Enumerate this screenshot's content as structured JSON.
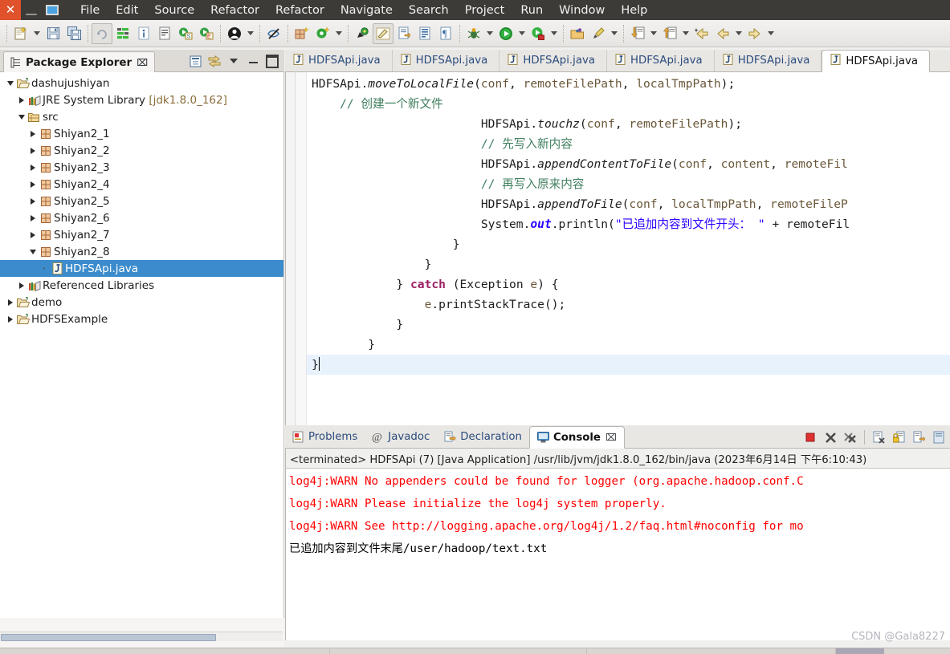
{
  "window": {
    "controls": [
      {
        "name": "close",
        "glyph": "✕"
      },
      {
        "name": "minimize",
        "glyph": "—"
      },
      {
        "name": "maximize",
        "glyph": ""
      }
    ],
    "menus": [
      "File",
      "Edit",
      "Source",
      "Refactor",
      "Refactor",
      "Navigate",
      "Search",
      "Project",
      "Run",
      "Window",
      "Help"
    ]
  },
  "toolbar": {
    "items": [
      {
        "icon": "new-wizard-icon",
        "dropdown": true
      },
      {
        "icon": "save-icon",
        "dropdown": false
      },
      {
        "icon": "save-all-icon",
        "dropdown": false
      },
      {
        "icon": "refresh-icon",
        "dropdown": false
      },
      {
        "icon": "build-all-icon",
        "dropdown": false
      },
      {
        "icon": "info-icon",
        "dropdown": false
      },
      {
        "icon": "open-task-icon",
        "dropdown": false
      },
      {
        "icon": "new-java-project-icon",
        "dropdown": false
      },
      {
        "icon": "new-ee-project-icon",
        "dropdown": false
      },
      {
        "icon": "user-icon",
        "dropdown": true
      },
      {
        "icon": "skip-breakpoints-icon",
        "dropdown": false
      },
      {
        "icon": "new-package-icon",
        "dropdown": false
      },
      {
        "icon": "new-class-icon",
        "dropdown": true
      },
      {
        "icon": "search-icon",
        "dropdown": false
      },
      {
        "icon": "pencil-highlight-icon",
        "dropdown": false
      },
      {
        "icon": "next-annotation-icon",
        "dropdown": false
      },
      {
        "icon": "toggle-block-selection-icon",
        "dropdown": false
      },
      {
        "icon": "show-whitespace-icon",
        "dropdown": false
      },
      {
        "icon": "debug-icon",
        "dropdown": true
      },
      {
        "icon": "run-icon",
        "dropdown": true
      },
      {
        "icon": "run-external-tools-icon",
        "dropdown": true
      },
      {
        "icon": "open-perspective-icon",
        "dropdown": false
      },
      {
        "icon": "quick-access-icon",
        "dropdown": true
      },
      {
        "icon": "download-icon",
        "dropdown": true
      },
      {
        "icon": "upload-icon",
        "dropdown": true
      },
      {
        "icon": "back-start-icon",
        "dropdown": false
      },
      {
        "icon": "back-icon",
        "dropdown": true
      },
      {
        "icon": "forward-icon",
        "dropdown": true
      }
    ]
  },
  "package_explorer": {
    "title": "Package Explorer",
    "close_glyph": "⌧",
    "tools": [
      {
        "name": "collapse-all-icon"
      },
      {
        "name": "link-with-editor-icon"
      },
      {
        "name": "view-menu-icon"
      },
      {
        "name": "minimize-view-icon"
      },
      {
        "name": "maximize-view-icon"
      }
    ],
    "tree": [
      {
        "label": "dashujushiyan",
        "indent": 0,
        "twist": "open",
        "icon": "project-icon",
        "selected": false
      },
      {
        "label": "JRE System Library ",
        "suffix": "[jdk1.8.0_162]",
        "indent": 1,
        "twist": "closed",
        "icon": "library-icon",
        "selected": false
      },
      {
        "label": "src",
        "indent": 1,
        "twist": "open",
        "icon": "source-folder-icon",
        "selected": false
      },
      {
        "label": "Shiyan2_1",
        "indent": 2,
        "twist": "closed",
        "icon": "package-icon",
        "selected": false
      },
      {
        "label": "Shiyan2_2",
        "indent": 2,
        "twist": "closed",
        "icon": "package-icon",
        "selected": false
      },
      {
        "label": "Shiyan2_3",
        "indent": 2,
        "twist": "closed",
        "icon": "package-icon",
        "selected": false
      },
      {
        "label": "Shiyan2_4",
        "indent": 2,
        "twist": "closed",
        "icon": "package-icon",
        "selected": false
      },
      {
        "label": "Shiyan2_5",
        "indent": 2,
        "twist": "closed",
        "icon": "package-icon",
        "selected": false
      },
      {
        "label": "Shiyan2_6",
        "indent": 2,
        "twist": "closed",
        "icon": "package-icon",
        "selected": false
      },
      {
        "label": "Shiyan2_7",
        "indent": 2,
        "twist": "closed",
        "icon": "package-icon",
        "selected": false
      },
      {
        "label": "Shiyan2_8",
        "indent": 2,
        "twist": "open",
        "icon": "package-icon",
        "selected": false
      },
      {
        "label": "HDFSApi.java",
        "indent": 3,
        "twist": "dot",
        "icon": "java-file-icon",
        "selected": true
      },
      {
        "label": "Referenced Libraries",
        "indent": 1,
        "twist": "closed",
        "icon": "library-icon",
        "selected": false
      },
      {
        "label": "demo",
        "indent": 0,
        "twist": "closed",
        "icon": "project-icon",
        "selected": false
      },
      {
        "label": "HDFSExample",
        "indent": 0,
        "twist": "closed",
        "icon": "project-icon",
        "selected": false
      }
    ]
  },
  "editor": {
    "tabs": [
      {
        "label": "HDFSApi.java",
        "active": false
      },
      {
        "label": "HDFSApi.java",
        "active": false
      },
      {
        "label": "HDFSApi.java",
        "active": false
      },
      {
        "label": "HDFSApi.java",
        "active": false
      },
      {
        "label": "HDFSApi.java",
        "active": false
      },
      {
        "label": "HDFSApi.java",
        "active": true
      }
    ],
    "code_lines": [
      {
        "current": false,
        "tokens": [
          {
            "t": "txt",
            "s": "HDFSApi."
          },
          {
            "t": "mth",
            "s": "moveToLocalFile"
          },
          {
            "t": "txt",
            "s": "("
          },
          {
            "t": "par",
            "s": "conf"
          },
          {
            "t": "txt",
            "s": ", "
          },
          {
            "t": "par",
            "s": "remoteFilePath"
          },
          {
            "t": "txt",
            "s": ", "
          },
          {
            "t": "par",
            "s": "localTmpPath"
          },
          {
            "t": "txt",
            "s": ");"
          }
        ]
      },
      {
        "current": false,
        "tokens": [
          {
            "t": "cmt",
            "s": "    // 创建一个新文件"
          }
        ]
      },
      {
        "current": false,
        "tokens": [
          {
            "t": "txt",
            "s": "                        HDFSApi."
          },
          {
            "t": "mth",
            "s": "touchz"
          },
          {
            "t": "txt",
            "s": "("
          },
          {
            "t": "par",
            "s": "conf"
          },
          {
            "t": "txt",
            "s": ", "
          },
          {
            "t": "par",
            "s": "remoteFilePath"
          },
          {
            "t": "txt",
            "s": ");"
          }
        ]
      },
      {
        "current": false,
        "tokens": [
          {
            "t": "cmt",
            "s": "                        // 先写入新内容"
          }
        ]
      },
      {
        "current": false,
        "tokens": [
          {
            "t": "txt",
            "s": "                        HDFSApi."
          },
          {
            "t": "mth",
            "s": "appendContentToFile"
          },
          {
            "t": "txt",
            "s": "("
          },
          {
            "t": "par",
            "s": "conf"
          },
          {
            "t": "txt",
            "s": ", "
          },
          {
            "t": "par",
            "s": "content"
          },
          {
            "t": "txt",
            "s": ", "
          },
          {
            "t": "par",
            "s": "remoteFil"
          }
        ]
      },
      {
        "current": false,
        "tokens": [
          {
            "t": "cmt",
            "s": "                        // 再写入原来内容"
          }
        ]
      },
      {
        "current": false,
        "tokens": [
          {
            "t": "txt",
            "s": "                        HDFSApi."
          },
          {
            "t": "mth",
            "s": "appendToFile"
          },
          {
            "t": "txt",
            "s": "("
          },
          {
            "t": "par",
            "s": "conf"
          },
          {
            "t": "txt",
            "s": ", "
          },
          {
            "t": "par",
            "s": "localTmpPath"
          },
          {
            "t": "txt",
            "s": ", "
          },
          {
            "t": "par",
            "s": "remoteFileP"
          }
        ]
      },
      {
        "current": false,
        "tokens": [
          {
            "t": "txt",
            "s": "                        System."
          },
          {
            "t": "sfld",
            "s": "out"
          },
          {
            "t": "txt",
            "s": ".println("
          },
          {
            "t": "str",
            "s": "\"已追加内容到文件开头： \""
          },
          {
            "t": "txt",
            "s": " + remoteFil"
          }
        ]
      },
      {
        "current": false,
        "tokens": [
          {
            "t": "txt",
            "s": "                    }"
          }
        ]
      },
      {
        "current": false,
        "tokens": [
          {
            "t": "txt",
            "s": "                }"
          }
        ]
      },
      {
        "current": false,
        "tokens": [
          {
            "t": "txt",
            "s": "            } "
          },
          {
            "t": "kw",
            "s": "catch"
          },
          {
            "t": "txt",
            "s": " (Exception "
          },
          {
            "t": "par",
            "s": "e"
          },
          {
            "t": "txt",
            "s": ") {"
          }
        ]
      },
      {
        "current": false,
        "tokens": [
          {
            "t": "txt",
            "s": "                "
          },
          {
            "t": "par",
            "s": "e"
          },
          {
            "t": "txt",
            "s": ".printStackTrace();"
          }
        ]
      },
      {
        "current": false,
        "tokens": [
          {
            "t": "txt",
            "s": "            }"
          }
        ]
      },
      {
        "current": false,
        "tokens": [
          {
            "t": "txt",
            "s": "        }"
          }
        ]
      },
      {
        "current": true,
        "tokens": [
          {
            "t": "txt",
            "s": "}"
          }
        ]
      }
    ]
  },
  "console_panel": {
    "tabs": [
      {
        "label": "Problems",
        "icon": "problems-icon",
        "active": false
      },
      {
        "label": "Javadoc",
        "icon": "javadoc-icon",
        "active": false
      },
      {
        "label": "Declaration",
        "icon": "declaration-icon",
        "active": false
      },
      {
        "label": "Console",
        "icon": "console-icon",
        "active": true
      }
    ],
    "close_glyph": "⌧",
    "tools": [
      {
        "name": "terminate-icon"
      },
      {
        "name": "remove-launch-icon"
      },
      {
        "name": "remove-all-terminated-icon"
      },
      {
        "name": "clear-console-icon"
      },
      {
        "name": "scroll-lock-icon"
      },
      {
        "name": "pin-console-icon"
      },
      {
        "name": "display-selected-console-icon"
      }
    ],
    "status_line": "<terminated> HDFSApi (7) [Java Application] /usr/lib/jvm/jdk1.8.0_162/bin/java (2023年6月14日 下午6:10:43)",
    "output": [
      {
        "type": "warn",
        "text": "log4j:WARN No appenders could be found for logger (org.apache.hadoop.conf.C"
      },
      {
        "type": "warn",
        "text": "log4j:WARN Please initialize the log4j system properly."
      },
      {
        "type": "warn",
        "text": "log4j:WARN See http://logging.apache.org/log4j/1.2/faq.html#noconfig for mo"
      },
      {
        "type": "norm",
        "text": "已追加内容到文件末尾/user/hadoop/text.txt"
      }
    ],
    "watermark": "CSDN @Gala8227"
  },
  "colors": {
    "titlebar_bg": "#3c3b37",
    "close_btn": "#e0522b",
    "selection": "#3c8ccd",
    "current_line": "#e8f2fd",
    "keyword": "#9c2063",
    "string": "#2a00ff",
    "comment": "#3f7f5f",
    "parameter": "#6a5739",
    "console_warn": "#ff0000"
  }
}
